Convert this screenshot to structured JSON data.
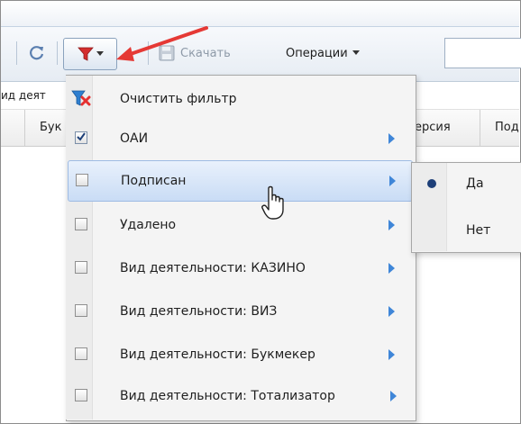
{
  "toolbar": {
    "refresh_icon": "refresh-icon",
    "filter_icon": "funnel-icon",
    "download_label": "Скачать",
    "operations_label": "Операции"
  },
  "subbar": {
    "text": "ид деят"
  },
  "grid": {
    "columns": [
      {
        "label": "Бук"
      },
      {
        "label": "ерсия"
      },
      {
        "label": "Под"
      }
    ]
  },
  "filter_menu": {
    "items": [
      {
        "label": "Очистить фильтр",
        "type": "action",
        "icon": "clear-filter-icon"
      },
      {
        "label": "ОАИ",
        "type": "checkbox",
        "checked": true,
        "submenu": true
      },
      {
        "label": "Подписан",
        "type": "checkbox",
        "checked": false,
        "submenu": true,
        "highlighted": true
      },
      {
        "label": "Удалено",
        "type": "checkbox",
        "checked": false,
        "submenu": true
      },
      {
        "label": "Вид деятельности: КАЗИНО",
        "type": "checkbox",
        "checked": false,
        "submenu": true
      },
      {
        "label": "Вид деятельности: ВИЗ",
        "type": "checkbox",
        "checked": false,
        "submenu": true
      },
      {
        "label": "Вид деятельности: Букмекер",
        "type": "checkbox",
        "checked": false,
        "submenu": true
      },
      {
        "label": "Вид деятельности: Тотализатор",
        "type": "checkbox",
        "checked": false,
        "submenu": true
      }
    ]
  },
  "submenu": {
    "items": [
      {
        "label": "Да",
        "selected": true
      },
      {
        "label": "Нет",
        "selected": false
      }
    ]
  },
  "colors": {
    "accent_arrow": "#e53935",
    "submenu_arrow": "#3f86d8",
    "highlight": "#c9dcf5",
    "radio_dot": "#1d3f78"
  }
}
